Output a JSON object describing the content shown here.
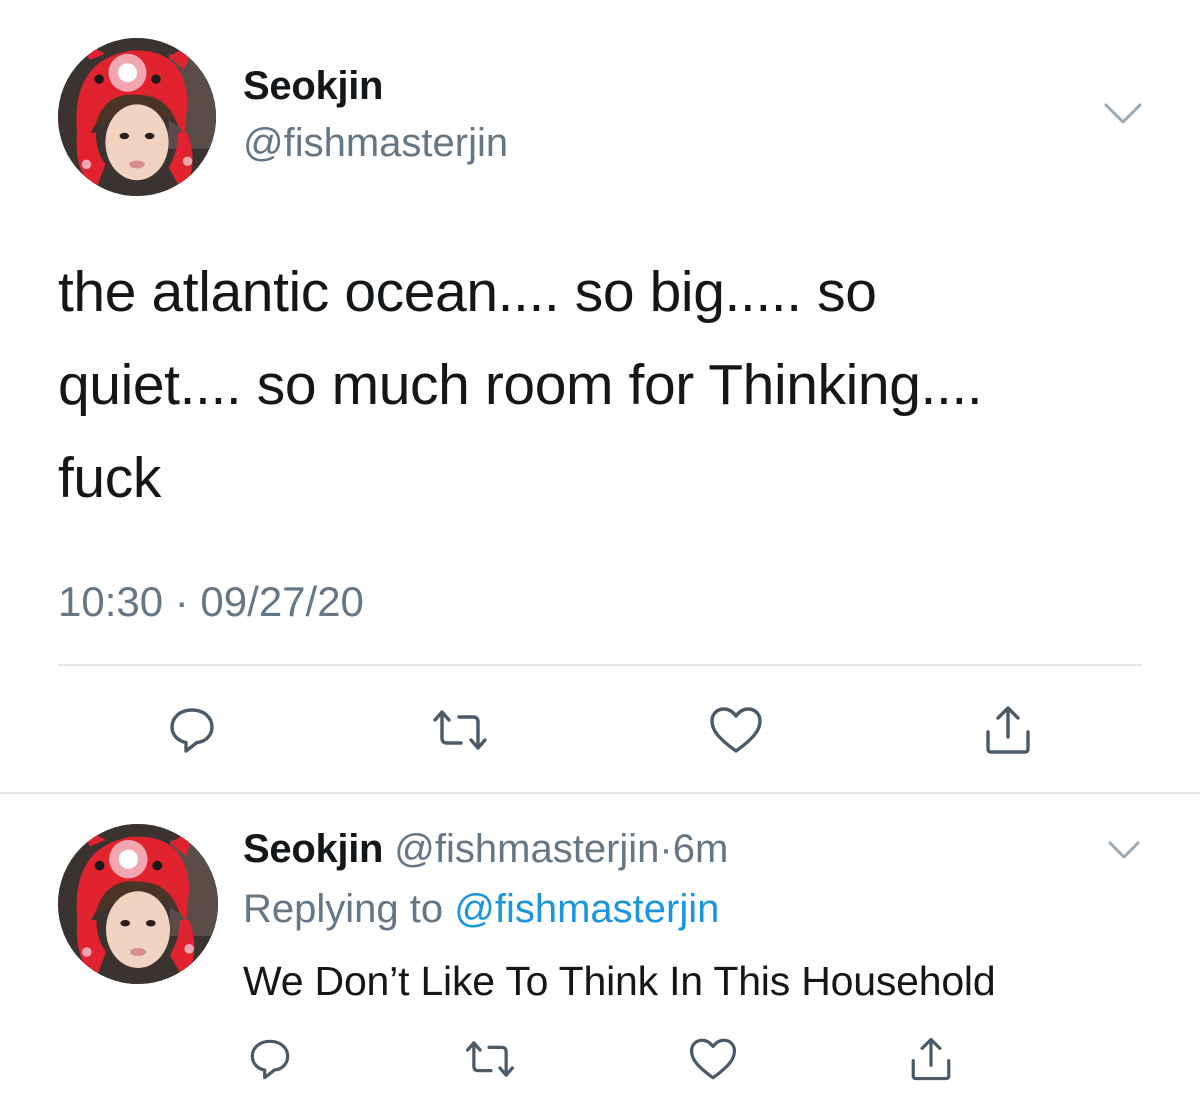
{
  "main_tweet": {
    "author_name": "Seokjin",
    "author_handle": "@fishmasterjin",
    "text": "the atlantic ocean.... so big..... so\nquiet.... so much room for Thinking....\nfuck",
    "timestamp": "10:30 · 09/27/20",
    "menu_icon": "chevron-down-icon",
    "actions": [
      {
        "icon": "reply-icon"
      },
      {
        "icon": "retweet-icon"
      },
      {
        "icon": "like-icon"
      },
      {
        "icon": "share-icon"
      }
    ]
  },
  "reply_tweet": {
    "author_name": "Seokjin",
    "author_handle": "@fishmasterjin",
    "separator": "·",
    "relative_time": "6m",
    "replying_label": "Replying to",
    "replying_to": "@fishmasterjin",
    "text": "We Don’t Like To Think In This Household",
    "menu_icon": "chevron-down-icon",
    "actions": [
      {
        "icon": "reply-icon"
      },
      {
        "icon": "retweet-icon"
      },
      {
        "icon": "like-icon"
      },
      {
        "icon": "share-icon"
      }
    ]
  },
  "colors": {
    "text": "#14171a",
    "secondary": "#657786",
    "link": "#1b95e0",
    "divider": "#e1e8ed",
    "avatar_hat": "#e0232e"
  }
}
